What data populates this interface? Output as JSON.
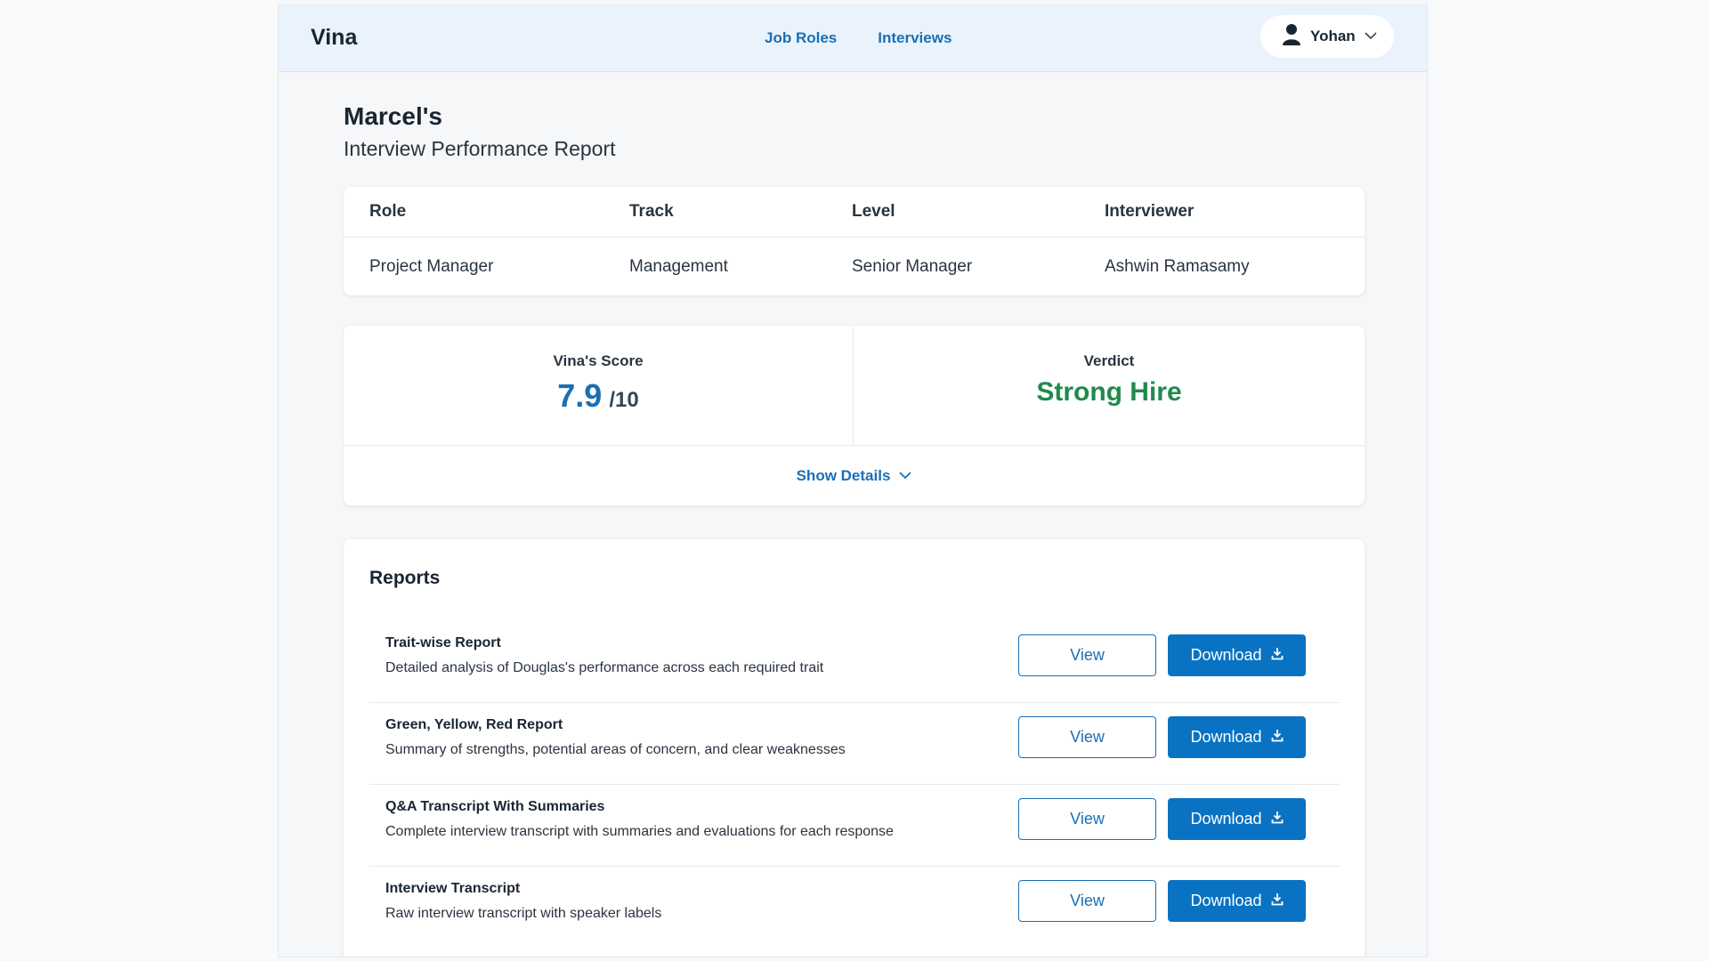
{
  "header": {
    "logo": "Vina",
    "nav": [
      {
        "label": "Job Roles"
      },
      {
        "label": "Interviews"
      }
    ],
    "user": {
      "name": "Yohan"
    }
  },
  "candidate": {
    "name": "Marcel's",
    "subtitle": "Interview Performance Report"
  },
  "info": {
    "headers": [
      "Role",
      "Track",
      "Level",
      "Interviewer"
    ],
    "values": [
      "Project Manager",
      "Management",
      "Senior Manager",
      "Ashwin Ramasamy"
    ]
  },
  "score": {
    "label": "Vina's Score",
    "value": "7.9",
    "out_of": "/10",
    "verdict_label": "Verdict",
    "verdict": "Strong Hire",
    "verdict_color": "#1f8a4c",
    "show_details": "Show Details"
  },
  "reports": {
    "title": "Reports",
    "items": [
      {
        "title": "Trait-wise Report",
        "description": "Detailed analysis of Douglas's performance across each required trait",
        "view_label": "View",
        "download_label": "Download"
      },
      {
        "title": "Green, Yellow, Red Report",
        "description": "Summary of strengths, potential areas of concern, and clear weaknesses",
        "view_label": "View",
        "download_label": "Download"
      },
      {
        "title": "Q&A Transcript With Summaries",
        "description": "Complete interview transcript with summaries and evaluations for each response",
        "view_label": "View",
        "download_label": "Download"
      },
      {
        "title": "Interview Transcript",
        "description": "Raw interview transcript with speaker labels",
        "view_label": "View",
        "download_label": "Download"
      }
    ]
  },
  "colors": {
    "accent": "#1a6fb5",
    "primary_button": "#0a72c2",
    "header_bg": "#eaf3fc"
  }
}
